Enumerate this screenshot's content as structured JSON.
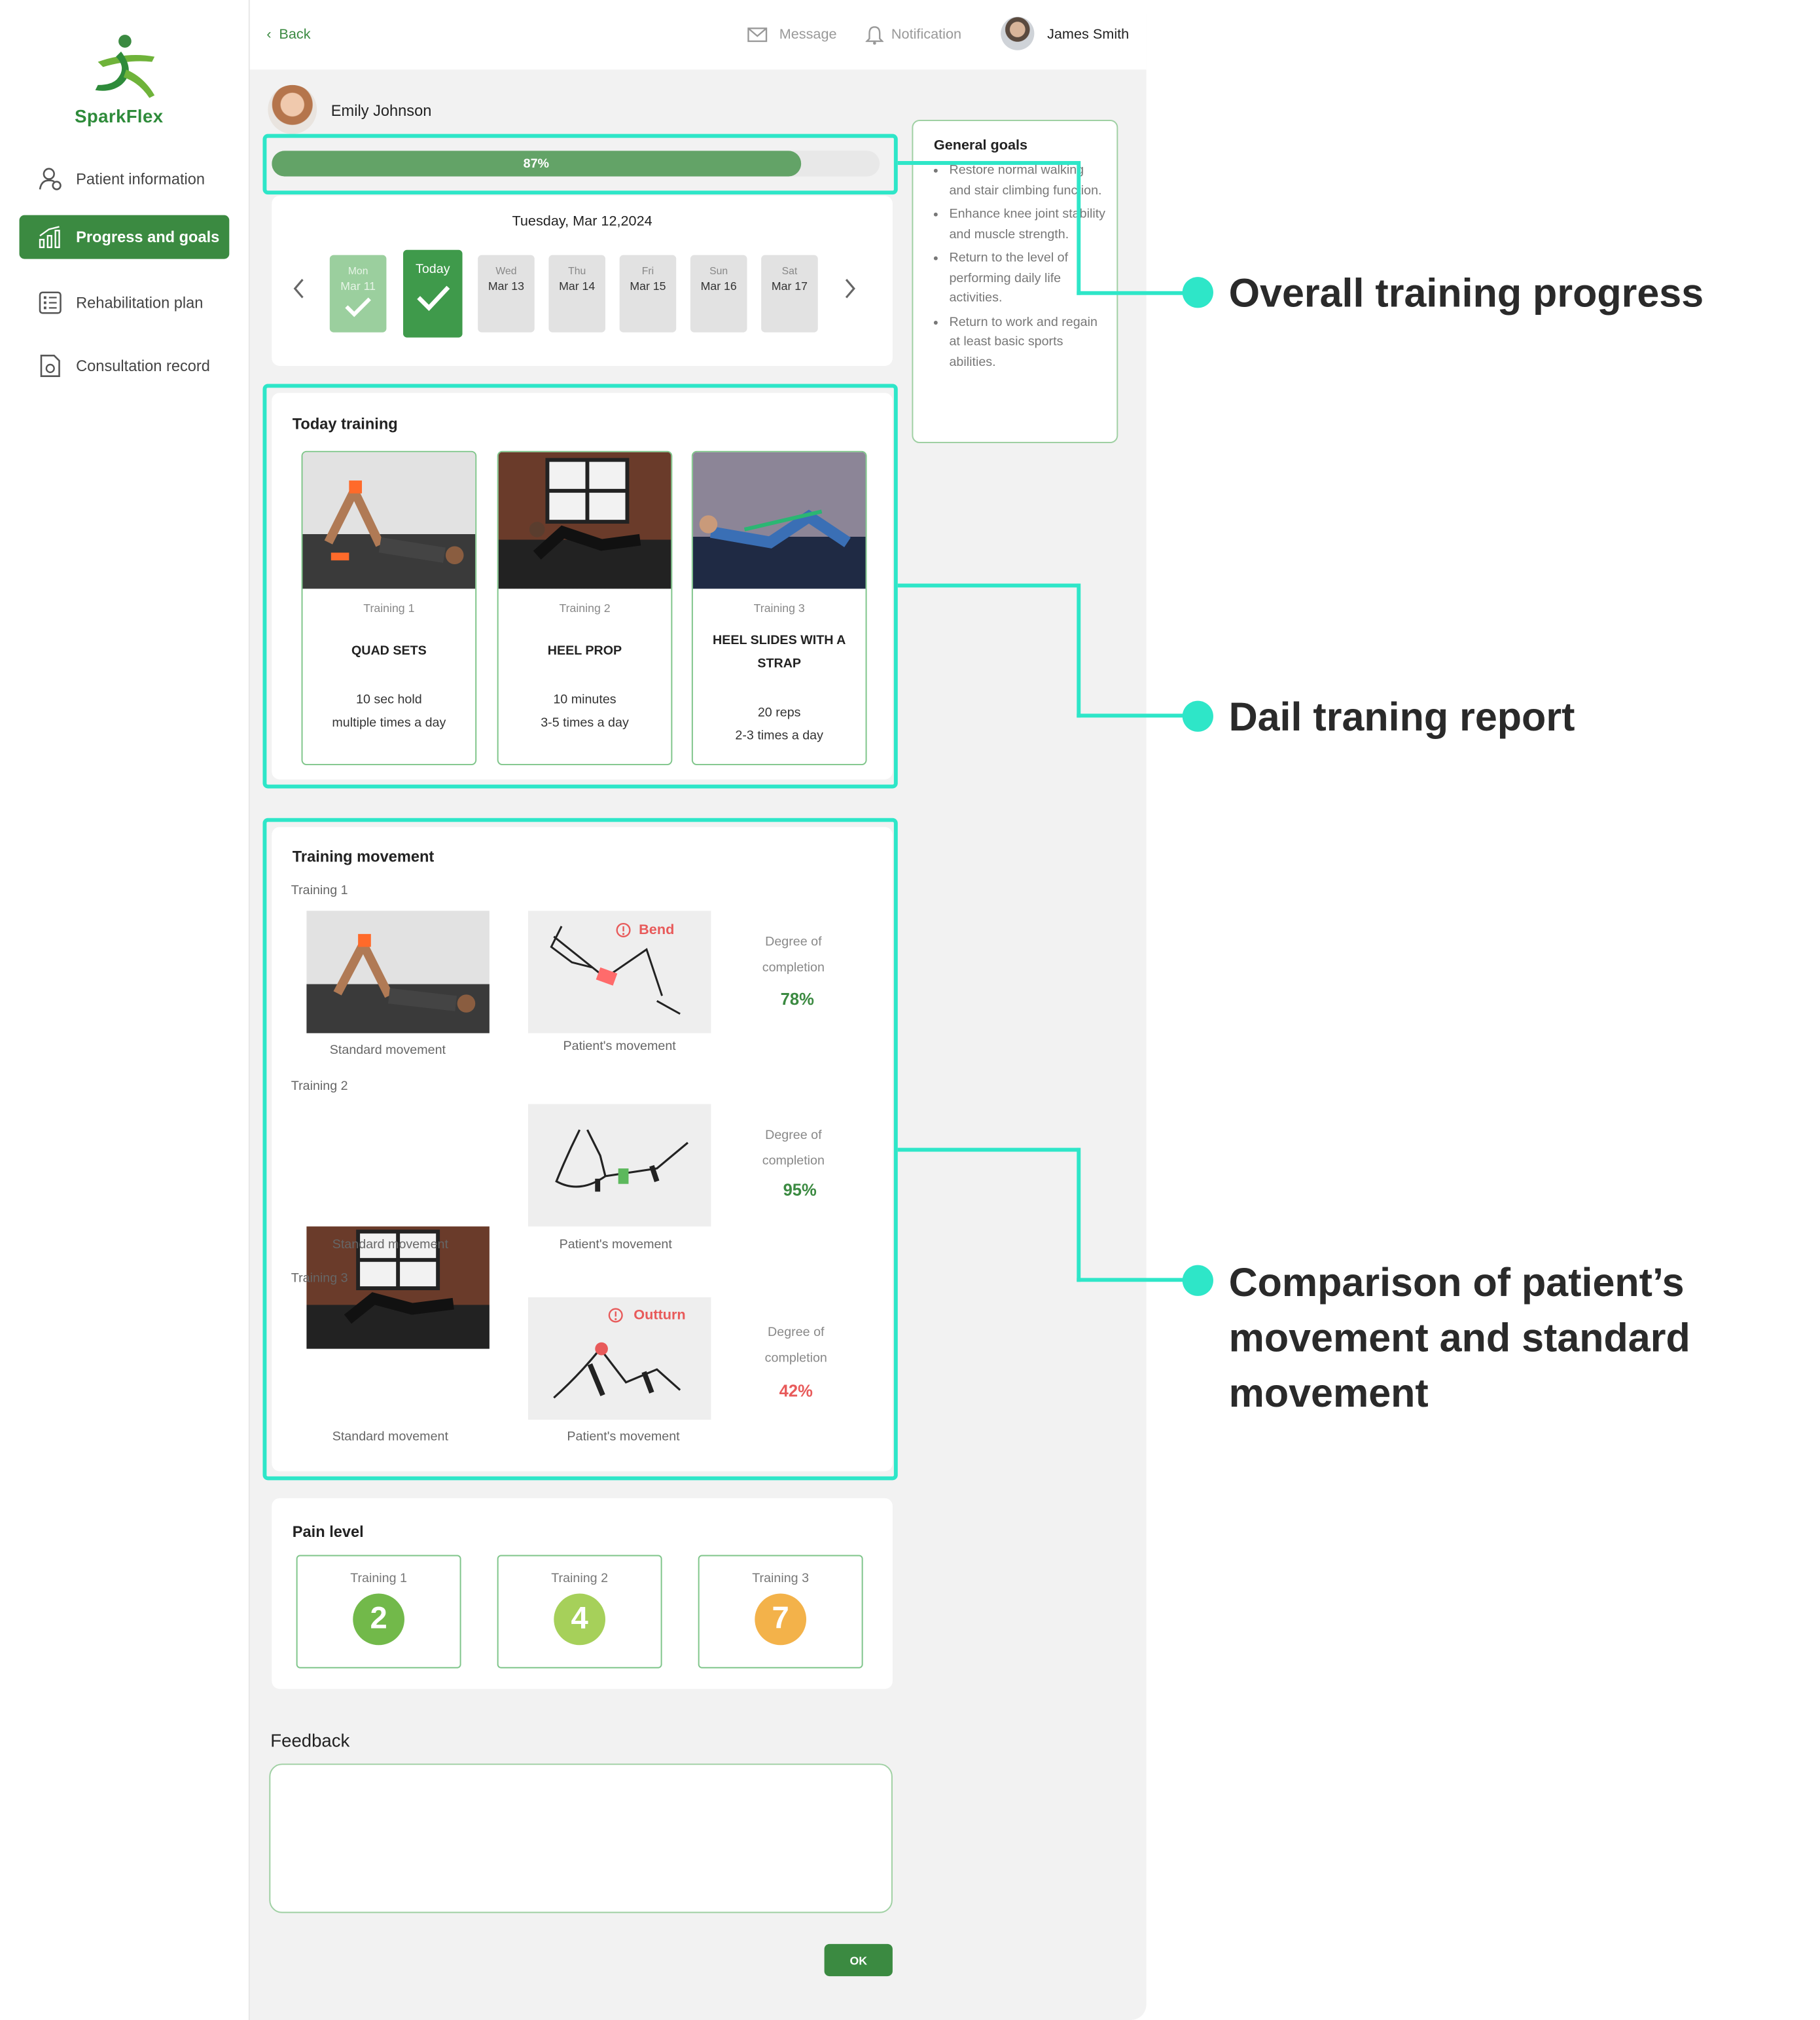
{
  "brand": {
    "name": "SparkFlex",
    "color": "#2e8b3a"
  },
  "sidebar": {
    "items": [
      {
        "label": "Patient information",
        "icon": "user-settings-icon",
        "active": false
      },
      {
        "label": "Progress and goals",
        "icon": "chart-up-icon",
        "active": true
      },
      {
        "label": "Rehabilitation plan",
        "icon": "checklist-icon",
        "active": false
      },
      {
        "label": "Consultation record",
        "icon": "document-icon",
        "active": false
      }
    ]
  },
  "topbar": {
    "back_label": "Back",
    "message_label": "Message",
    "notification_label": "Notification",
    "user_name": "James Smith"
  },
  "patient": {
    "name": "Emily Johnson"
  },
  "progress": {
    "value": 0.87,
    "label": "87%"
  },
  "calendar": {
    "date_title": "Tuesday, Mar 12,2024",
    "days": [
      {
        "dow": "Mon",
        "date": "Mar 11",
        "state": "done"
      },
      {
        "dow": "Today",
        "date": "",
        "state": "today"
      },
      {
        "dow": "Wed",
        "date": "Mar 13",
        "state": "upcoming"
      },
      {
        "dow": "Thu",
        "date": "Mar 14",
        "state": "upcoming"
      },
      {
        "dow": "Fri",
        "date": "Mar 15",
        "state": "upcoming"
      },
      {
        "dow": "Sun",
        "date": "Mar 16",
        "state": "upcoming"
      },
      {
        "dow": "Sat",
        "date": "Mar 17",
        "state": "upcoming"
      }
    ]
  },
  "goals": {
    "title": "General goals",
    "items": [
      "Restore normal walking and stair climbing function.",
      "Enhance knee joint stability and muscle strength.",
      "Return to the level of performing daily life activities.",
      "Return to work and regain at least basic sports abilities."
    ]
  },
  "today_training": {
    "title": "Today training",
    "cards": [
      {
        "label": "Training 1",
        "name": "QUAD SETS",
        "line1": "10 sec hold",
        "line2": "multiple times a day"
      },
      {
        "label": "Training 2",
        "name": "HEEL PROP",
        "line1": "10 minutes",
        "line2": "3-5 times a day"
      },
      {
        "label": "Training 3",
        "name": "HEEL SLIDES WITH A STRAP",
        "line1": "20 reps",
        "line2": "2-3 times a day"
      }
    ]
  },
  "training_movement": {
    "title": "Training movement",
    "standard_caption": "Standard movement",
    "patient_caption": "Patient's movement",
    "degree_label_1": "Degree of",
    "degree_label_2": "completion",
    "rows": [
      {
        "label": "Training 1",
        "warning": "Bend",
        "completion": "78%",
        "status": "good"
      },
      {
        "label": "Training 2",
        "warning": "",
        "completion": "95%",
        "status": "good"
      },
      {
        "label": "Training 3",
        "warning": "Outturn",
        "completion": "42%",
        "status": "bad"
      }
    ]
  },
  "pain": {
    "title": "Pain level",
    "items": [
      {
        "label": "Training 1",
        "value": "2",
        "color": "#72b94a"
      },
      {
        "label": "Training 2",
        "value": "4",
        "color": "#a6d05a"
      },
      {
        "label": "Training 3",
        "value": "7",
        "color": "#f3b24a"
      }
    ]
  },
  "feedback": {
    "label": "Feedback",
    "value": "",
    "ok_label": "OK"
  },
  "annotations": {
    "overall": "Overall training progress",
    "daily": "Dail traning report",
    "comparison_1": "Comparison of patient’s",
    "comparison_2": "movement and standard",
    "comparison_3": "movement"
  },
  "colors": {
    "accent": "#3b8a41",
    "highlight": "#2ee6c8",
    "good": "#3b8a41",
    "bad": "#e85a5a"
  }
}
